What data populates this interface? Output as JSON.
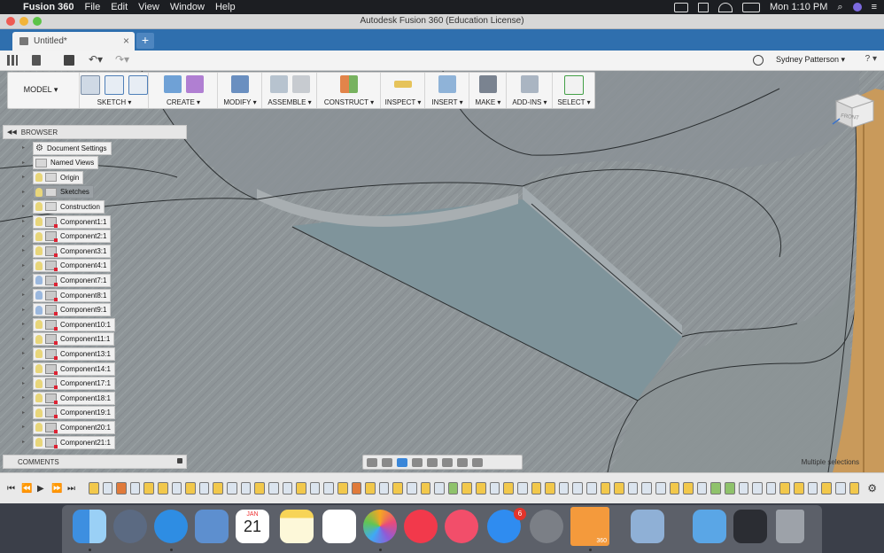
{
  "menubar": {
    "app_name": "Fusion 360",
    "items": [
      "File",
      "Edit",
      "View",
      "Window",
      "Help"
    ],
    "clock": "Mon 1:10 PM"
  },
  "window": {
    "title": "Autodesk Fusion 360 (Education License)"
  },
  "tab": {
    "document_name": "Untitled*",
    "close": "×",
    "add": "+"
  },
  "quick_access": {
    "user_name": "Sydney Patterson ▾",
    "help": "? ▾"
  },
  "toolbar": {
    "workspace": "MODEL ▾",
    "groups": [
      {
        "label": "SKETCH ▾"
      },
      {
        "label": "CREATE ▾"
      },
      {
        "label": "MODIFY ▾"
      },
      {
        "label": "ASSEMBLE ▾"
      },
      {
        "label": "CONSTRUCT ▾"
      },
      {
        "label": "INSPECT ▾"
      },
      {
        "label": "INSERT ▾"
      },
      {
        "label": "MAKE ▾"
      },
      {
        "label": "ADD-INS ▾"
      },
      {
        "label": "SELECT ▾"
      }
    ]
  },
  "viewcube": {
    "face": "FRONT"
  },
  "browser": {
    "title": "BROWSER",
    "items": [
      {
        "label": "Document Settings",
        "kind": "gear"
      },
      {
        "label": "Named Views",
        "kind": "folder"
      },
      {
        "label": "Origin",
        "kind": "folder-bulb"
      },
      {
        "label": "Sketches",
        "kind": "folder-bulb",
        "selected": true
      },
      {
        "label": "Construction",
        "kind": "folder-bulb"
      },
      {
        "label": "Component1:1",
        "kind": "component"
      },
      {
        "label": "Component2:1",
        "kind": "component"
      },
      {
        "label": "Component3:1",
        "kind": "component"
      },
      {
        "label": "Component4:1",
        "kind": "component"
      },
      {
        "label": "Component7:1",
        "kind": "component",
        "hidden": true
      },
      {
        "label": "Component8:1",
        "kind": "component",
        "hidden": true
      },
      {
        "label": "Component9:1",
        "kind": "component",
        "hidden": true
      },
      {
        "label": "Component10:1",
        "kind": "component"
      },
      {
        "label": "Component11:1",
        "kind": "component"
      },
      {
        "label": "Component13:1",
        "kind": "component"
      },
      {
        "label": "Component14:1",
        "kind": "component"
      },
      {
        "label": "Component17:1",
        "kind": "component"
      },
      {
        "label": "Component18:1",
        "kind": "component"
      },
      {
        "label": "Component19:1",
        "kind": "component"
      },
      {
        "label": "Component20:1",
        "kind": "component"
      },
      {
        "label": "Component21:1",
        "kind": "component"
      }
    ]
  },
  "comments": {
    "title": "COMMENTS"
  },
  "status": {
    "selection": "Multiple selections"
  },
  "dock": {
    "calendar_month": "JAN",
    "calendar_day": "21",
    "appstore_badge": "6",
    "fusion_label": "360"
  }
}
